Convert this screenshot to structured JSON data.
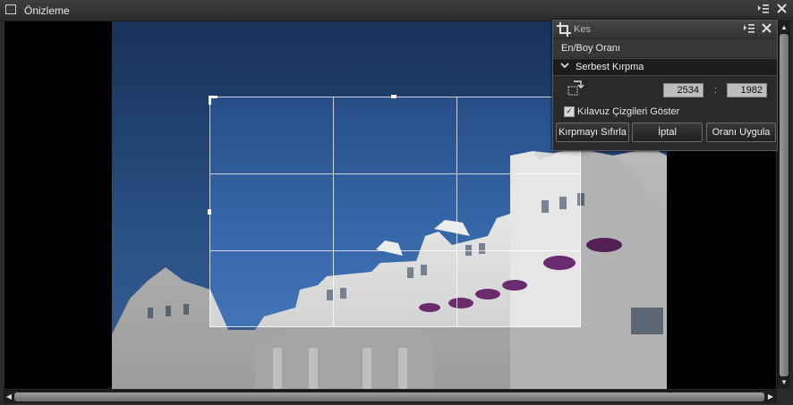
{
  "window": {
    "title": "Önizleme",
    "icons": {
      "window": "window-icon",
      "menu": "menu-list-icon",
      "close": "close-icon"
    }
  },
  "crop_panel": {
    "title": "Kes",
    "aspect_label": "En/Boy Oranı",
    "mode_selected": "Serbest Kırpma",
    "width_value": "2534",
    "separator": ":",
    "height_value": "1982",
    "guides_label": "Kılavuz Çizgileri Göster",
    "guides_checked": true,
    "buttons": {
      "reset": "Kırpmayı Sıfırla",
      "cancel": "İptal",
      "apply": "Oranı Uygula"
    },
    "icons": {
      "crop": "crop-icon",
      "swap": "swap-dimensions-icon",
      "menu": "menu-list-icon",
      "close": "close-icon"
    }
  },
  "colors": {
    "sky": "#2f5a96",
    "panel_bg": "#2a2a2a",
    "viewport_bg": "#000000"
  }
}
